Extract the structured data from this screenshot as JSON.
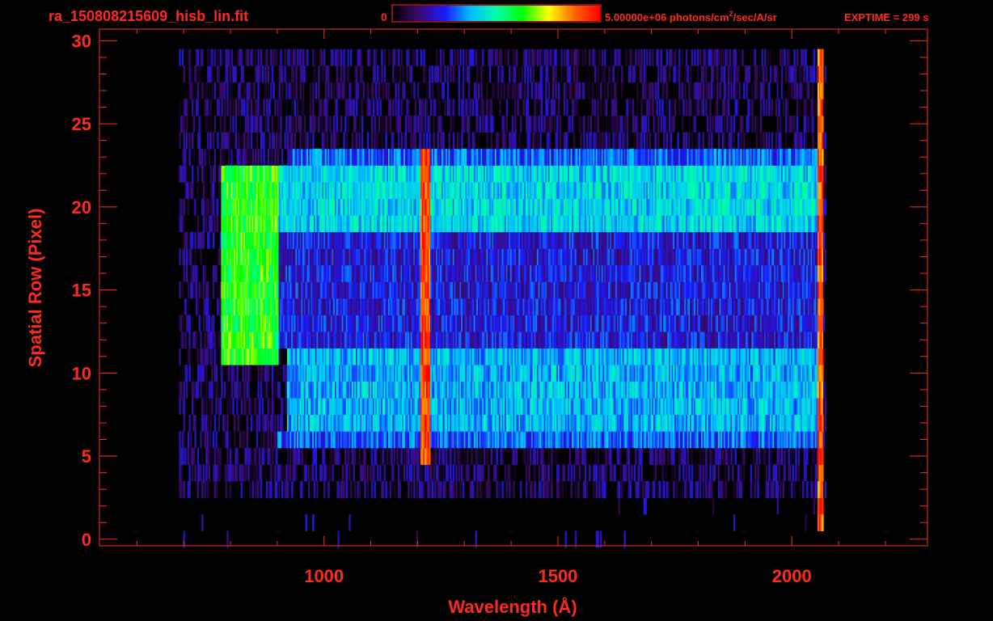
{
  "header": {
    "filename": "ra_150808215609_hisb_lin.fit",
    "colorbar_min": "0",
    "colorbar_max_prefix": "5.00000e+06 photons/cm",
    "colorbar_max_sup": "2",
    "colorbar_max_suffix": "/sec/A/sr",
    "exptime": "EXPTIME = 299 s"
  },
  "colors": {
    "text": "#ff2a1a",
    "background": "#000000",
    "colormap": [
      "#000000",
      "#3c0a6e",
      "#1a1aff",
      "#00bfff",
      "#00ffb0",
      "#00ff00",
      "#ffff00",
      "#ff6600",
      "#ff0000"
    ]
  },
  "chart_data": {
    "type": "heatmap",
    "title": "",
    "xlabel": "Wavelength (Å)",
    "ylabel": "Spatial Row (Pixel)",
    "xlim": [
      520,
      2290
    ],
    "ylim": [
      -0.4,
      30.7
    ],
    "xticks": [
      1000,
      1500,
      2000
    ],
    "yticks": [
      0,
      5,
      10,
      15,
      20,
      25,
      30
    ],
    "xtick_labels": [
      "1000",
      "1500",
      "2000"
    ],
    "ytick_labels": [
      "0",
      "5",
      "10",
      "15",
      "20",
      "25",
      "30"
    ],
    "xminor_step": 100,
    "yminor_step": 1,
    "grid": false,
    "colorbar": {
      "min": 0,
      "max": 5000000,
      "units": "photons/cm^2/sec/A/sr"
    },
    "spectrum_extent_wavelength": [
      690,
      2070
    ],
    "regions": [
      {
        "feature": "noise floor",
        "rows": [
          3,
          30
        ],
        "wavelength": [
          690,
          2070
        ],
        "level": 0.12
      },
      {
        "feature": "upper band",
        "rows": [
          19,
          23
        ],
        "wavelength": [
          840,
          2060
        ],
        "level": 0.42
      },
      {
        "feature": "upper band edge",
        "rows": [
          23,
          24
        ],
        "wavelength": [
          930,
          2060
        ],
        "level": 0.3
      },
      {
        "feature": "lower band",
        "rows": [
          7,
          12
        ],
        "wavelength": [
          920,
          2060
        ],
        "level": 0.38
      },
      {
        "feature": "lower band base",
        "rows": [
          6,
          7
        ],
        "wavelength": [
          900,
          2060
        ],
        "level": 0.3
      },
      {
        "feature": "middle region",
        "rows": [
          12,
          19
        ],
        "wavelength": [
          800,
          2060
        ],
        "level": 0.22
      },
      {
        "feature": "Lyman-alpha line",
        "rows": [
          5,
          24
        ],
        "wavelength": [
          1205,
          1225
        ],
        "level": 0.92
      },
      {
        "feature": "curved arc",
        "rows": [
          11,
          23
        ],
        "wavelength": [
          780,
          900
        ],
        "level": 0.62
      },
      {
        "feature": "red edge",
        "rows": [
          1,
          30
        ],
        "wavelength": [
          2055,
          2065
        ],
        "level": 0.9
      }
    ]
  }
}
